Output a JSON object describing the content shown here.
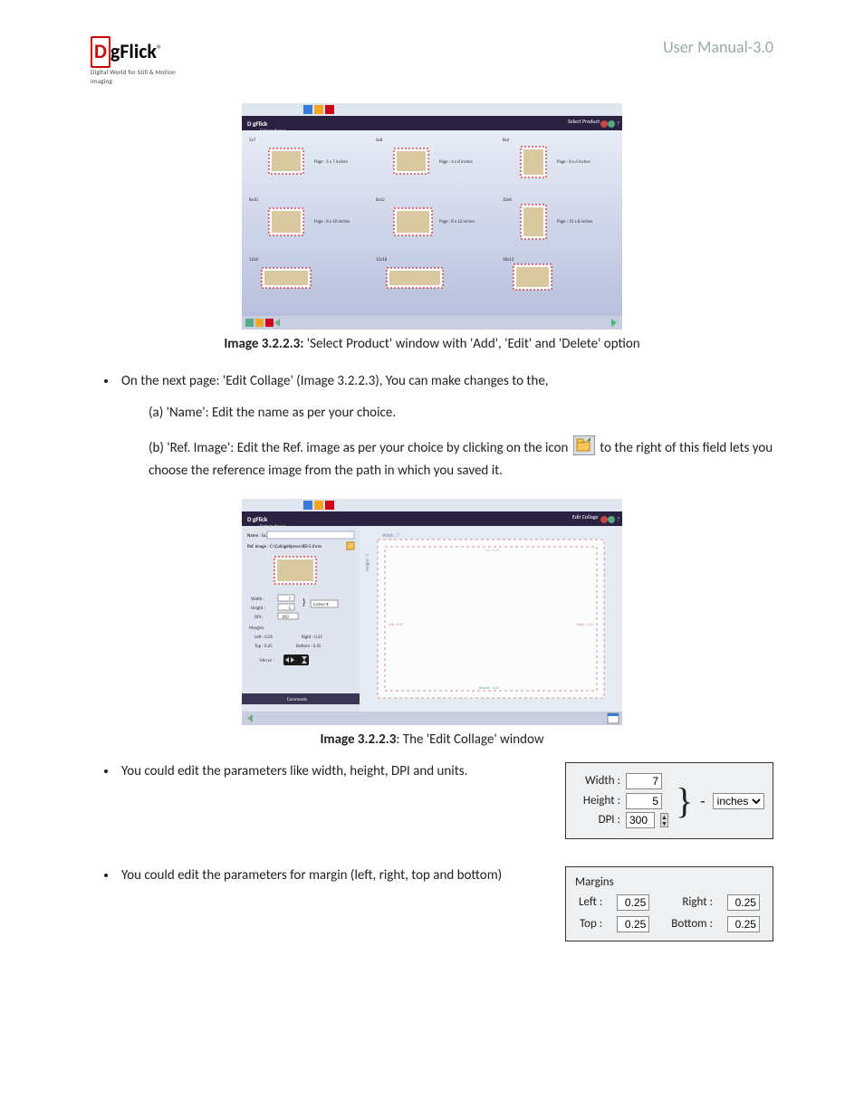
{
  "header": {
    "logo_d": "D",
    "logo_g": "g",
    "logo_rest": "Flick",
    "logo_r": "®",
    "tagline": "Digital World for Still & Motion Imaging",
    "manual": "User Manual-3.0"
  },
  "fig1": {
    "caption_bold": "Image 3.2.2.3:",
    "caption_rest": " 'Select Product' window with 'Add', 'Edit' and 'Delete' option",
    "app_title": "Collage Xpress",
    "select_product": "Select Product",
    "collage_xpress": "Collage Xpress",
    "tiles": [
      {
        "name": "5x7",
        "desc": "Page : 5 x 7 inches"
      },
      {
        "name": "6x8",
        "desc": "Page : 6 x 8 inches"
      },
      {
        "name": "8x6",
        "desc": "Page : 8 x 6 inches"
      },
      {
        "name": "8x10",
        "desc": "Page : 8 x 10 inches"
      },
      {
        "name": "8x12",
        "desc": "Page : 8 x 12 inches"
      },
      {
        "name": "10x8",
        "desc": "Page : 10 x 8 inches"
      },
      {
        "name": "12x8",
        "desc": ""
      },
      {
        "name": "12x18",
        "desc": ""
      },
      {
        "name": "18x12",
        "desc": ""
      }
    ]
  },
  "bullet1": "On the next page: 'Edit Collage' (Image 3.2.2.3), You can make changes to the,",
  "sub_a": "(a) 'Name': Edit the name as per your choice.",
  "sub_b_1": "(b) 'Ref. Image': Edit the Ref. image as per your choice by clicking on the icon ",
  "sub_b_2": " to the right of this field lets you choose the reference image from the path in which you saved it.",
  "fig2": {
    "caption_bold": "Image 3.2.2.3",
    "caption_rest": ": The 'Edit Collage' window",
    "edit_collage": "Edit Collage",
    "name_label": "Name :",
    "name_val": "5x7",
    "ref_label": "Ref. Image :",
    "ref_val": "C:\\CollageXpress\\RD-5.0\\res",
    "width_label": "Width :",
    "width_val": "7",
    "height_label": "Height :",
    "height_val": "5",
    "dpi_label": "DPI :",
    "dpi_val": "300",
    "units": "inches",
    "margins": "Margins",
    "left": "Left :",
    "left_v": "0.25",
    "right": "Right :",
    "right_v": "0.25",
    "top": "Top :",
    "top_v": "0.25",
    "bottom": "Bottom :",
    "bottom_v": "0.25",
    "mirror": "Mirror :",
    "comments": "Comments",
    "page_w": "Width : 7",
    "page_h": "Height : 5",
    "page_top": "Top : 0.25",
    "page_left": "Left : 0.25",
    "page_right": "Right : 0.25",
    "page_bottom": "Bottom : 0.25"
  },
  "bullet2": "You could edit the parameters like width, height, DPI and units.",
  "bullet3": "You could edit the parameters for margin (left, right, top and bottom)",
  "dim_panel": {
    "width_l": "Width :",
    "width_v": "7",
    "height_l": "Height :",
    "height_v": "5",
    "dpi_l": "DPI :",
    "dpi_v": "300",
    "units": "inches"
  },
  "marg_panel": {
    "title": "Margins",
    "left_l": "Left :",
    "left_v": "0.25",
    "right_l": "Right :",
    "right_v": "0.25",
    "top_l": "Top :",
    "top_v": "0.25",
    "bottom_l": "Bottom :",
    "bottom_v": "0.25"
  }
}
